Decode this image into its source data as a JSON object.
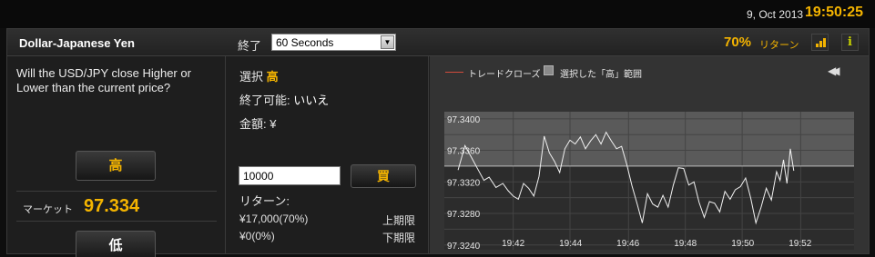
{
  "topbar": {
    "date": "9, Oct 2013",
    "time": "19:50:25"
  },
  "header": {
    "pair": "Dollar-Japanese Yen",
    "expiry_label": "終了",
    "expiry_value": "60 Seconds",
    "return_pct": "70%",
    "return_label": "リターン"
  },
  "left": {
    "question": "Will the USD/JPY close Higher or Lower than the current price?",
    "high_button": "高",
    "market_label": "マーケット",
    "market_value": "97.334",
    "low_button": "低"
  },
  "middle": {
    "selection_label": "選択",
    "selection_value": "高",
    "close_possible_label": "終了可能:",
    "close_possible_value": "いいえ",
    "amount_label": "金額: ¥",
    "amount_value": "10000",
    "buy_button": "買",
    "returns_label": "リターン:",
    "upper_amount": "¥17,000(70%)",
    "upper_label": "上期限",
    "lower_amount": "¥0(0%)",
    "lower_label": "下期限"
  },
  "chart_data": {
    "type": "line",
    "legend": [
      "トレードクローズ",
      "選択した「高」範囲"
    ],
    "y_ticks": [
      "97.3400",
      "97.3360",
      "97.3320",
      "97.3280",
      "97.3240"
    ],
    "x_ticks": [
      "19:42",
      "19:44",
      "19:46",
      "19:48",
      "19:50",
      "19:52"
    ],
    "ylim": [
      97.3234,
      97.3409
    ],
    "xlim": [
      19.66,
      19.898
    ],
    "highlight_range_from": 97.334,
    "trade_close_line": 97.334,
    "grid": true,
    "series": [
      {
        "x": [
          19.668,
          19.672,
          19.676,
          19.679,
          19.683,
          19.686,
          19.69,
          19.694,
          19.697,
          19.7,
          19.703,
          19.706,
          19.709,
          19.712,
          19.715,
          19.718,
          19.721,
          19.724,
          19.727,
          19.73,
          19.733,
          19.736,
          19.739,
          19.742,
          19.745,
          19.748,
          19.751,
          19.754,
          19.757,
          19.76,
          19.763,
          19.766,
          19.769,
          19.772,
          19.775,
          19.778,
          19.781,
          19.784,
          19.787,
          19.79,
          19.793,
          19.796,
          19.799,
          19.802,
          19.805,
          19.808,
          19.811,
          19.814,
          19.817,
          19.82,
          19.823,
          19.826,
          19.829,
          19.832,
          19.835,
          19.838,
          19.841,
          19.844,
          19.847,
          19.85,
          19.853,
          19.855,
          19.857,
          19.859,
          19.861,
          19.863
        ],
        "y": [
          97.3335,
          97.3366,
          97.335,
          97.3338,
          97.3322,
          97.3326,
          97.3313,
          97.3318,
          97.3309,
          97.3302,
          97.3298,
          97.3318,
          97.3312,
          97.3302,
          97.3327,
          97.3378,
          97.3357,
          97.3346,
          97.3332,
          97.3362,
          97.3373,
          97.3368,
          97.3377,
          97.3362,
          97.3372,
          97.338,
          97.3368,
          97.3383,
          97.3372,
          97.3362,
          97.3365,
          97.3342,
          97.3315,
          97.3292,
          97.3268,
          97.3305,
          97.3292,
          97.3288,
          97.3303,
          97.3288,
          97.3316,
          97.3338,
          97.3337,
          97.3316,
          97.332,
          97.3294,
          97.3275,
          97.3295,
          97.3293,
          97.3282,
          97.3308,
          97.3298,
          97.331,
          97.3314,
          97.3325,
          97.3299,
          97.3268,
          97.3288,
          97.3312,
          97.3297,
          97.3333,
          97.3322,
          97.3348,
          97.3318,
          97.3362,
          97.3334
        ]
      }
    ]
  }
}
